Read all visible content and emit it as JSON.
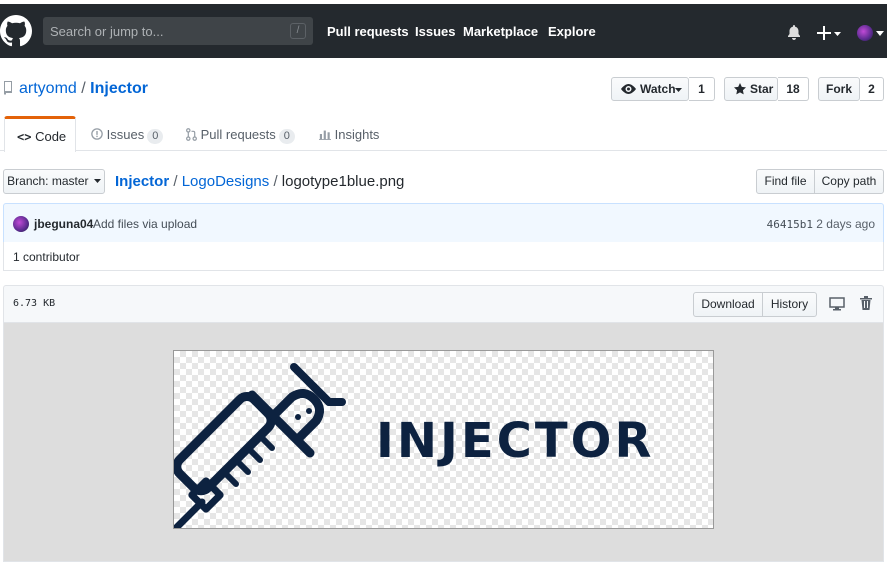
{
  "header": {
    "search_placeholder": "Search or jump to...",
    "search_shortcut": "/",
    "nav": [
      "Pull requests",
      "Issues",
      "Marketplace",
      "Explore"
    ]
  },
  "repo": {
    "owner": "artyomd",
    "separator": "/",
    "name": "Injector",
    "watch_label": "Watch",
    "watch_count": "1",
    "star_label": "Star",
    "star_count": "18",
    "fork_label": "Fork",
    "fork_count": "2"
  },
  "tabs": [
    {
      "label": "Code"
    },
    {
      "label": "Issues",
      "count": "0"
    },
    {
      "label": "Pull requests",
      "count": "0"
    },
    {
      "label": "Insights"
    }
  ],
  "breadcrumb": {
    "branch_label": "Branch: master",
    "repo": "Injector",
    "folder": "LogoDesigns",
    "file": "logotype1blue.png",
    "sep": "/",
    "find_file": "Find file",
    "copy_path": "Copy path"
  },
  "commit": {
    "author": "jbeguna04",
    "message": "Add files via upload",
    "sha": "46415b1",
    "time": "2 days ago"
  },
  "contributors": "1 contributor",
  "file": {
    "size": "6.73 KB",
    "download": "Download",
    "history": "History",
    "logo_text": "INJECTOR"
  },
  "colors": {
    "header_bg": "#24292e",
    "link": "#0366d6",
    "tab_accent": "#e36209",
    "logo_navy": "#0d2240"
  }
}
